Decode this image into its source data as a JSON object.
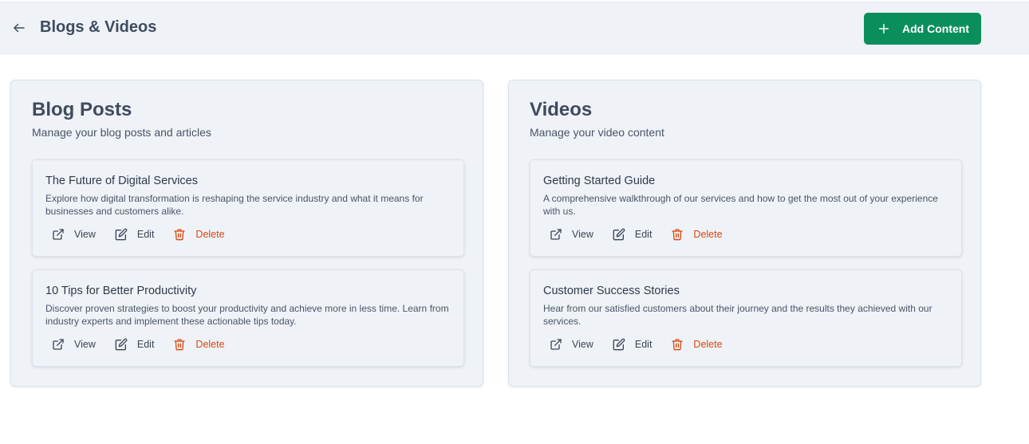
{
  "header": {
    "back_icon": "arrow-left-icon",
    "title": "Blogs & Videos",
    "add_button": {
      "label": "Add Content",
      "icon": "plus-icon",
      "color": "#0a8f5c"
    }
  },
  "panels": [
    {
      "title": "Blog Posts",
      "subtitle": "Manage your blog posts and articles",
      "items": [
        {
          "title": "The Future of Digital Services",
          "description": "Explore how digital transformation is reshaping the service industry and what it means for businesses and customers alike.",
          "actions": {
            "view": "View",
            "edit": "Edit",
            "delete": "Delete"
          }
        },
        {
          "title": "10 Tips for Better Productivity",
          "description": "Discover proven strategies to boost your productivity and achieve more in less time. Learn from industry experts and implement these actionable tips today.",
          "actions": {
            "view": "View",
            "edit": "Edit",
            "delete": "Delete"
          }
        }
      ]
    },
    {
      "title": "Videos",
      "subtitle": "Manage your video content",
      "items": [
        {
          "title": "Getting Started Guide",
          "description": "A comprehensive walkthrough of our services and how to get the most out of your experience with us.",
          "actions": {
            "view": "View",
            "edit": "Edit",
            "delete": "Delete"
          }
        },
        {
          "title": "Customer Success Stories",
          "description": "Hear from our satisfied customers about their journey and the results they achieved with our services.",
          "actions": {
            "view": "View",
            "edit": "Edit",
            "delete": "Delete"
          }
        }
      ]
    }
  ],
  "icons": {
    "view": "external-link-icon",
    "edit": "edit-icon",
    "delete": "trash-icon"
  },
  "colors": {
    "accent": "#0a8f5c",
    "danger": "#d9480f",
    "panel_bg": "#eff2f7"
  }
}
